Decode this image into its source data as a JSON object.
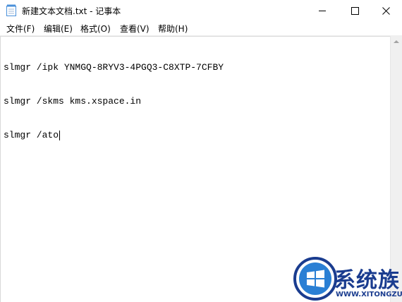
{
  "window": {
    "title": "新建文本文档.txt - 记事本"
  },
  "controls": {
    "minimize_icon": "minimize-icon",
    "maximize_icon": "maximize-icon",
    "close_icon": "close-icon"
  },
  "menu": {
    "items": [
      {
        "label": "文件(F)"
      },
      {
        "label": "编辑(E)"
      },
      {
        "label": "格式(O)"
      },
      {
        "label": "查看(V)"
      },
      {
        "label": "帮助(H)"
      }
    ]
  },
  "editor": {
    "lines": [
      "slmgr /ipk YNMGQ-8RYV3-4PGQ3-C8XTP-7CFBY",
      "slmgr /skms kms.xspace.in",
      "slmgr /ato"
    ]
  },
  "watermark": {
    "brand": "系统族",
    "url": "WWW.XITONGZU.COM"
  },
  "colors": {
    "watermark_blue": "#1a3c8f",
    "accent_blue": "#2a7fd4"
  }
}
